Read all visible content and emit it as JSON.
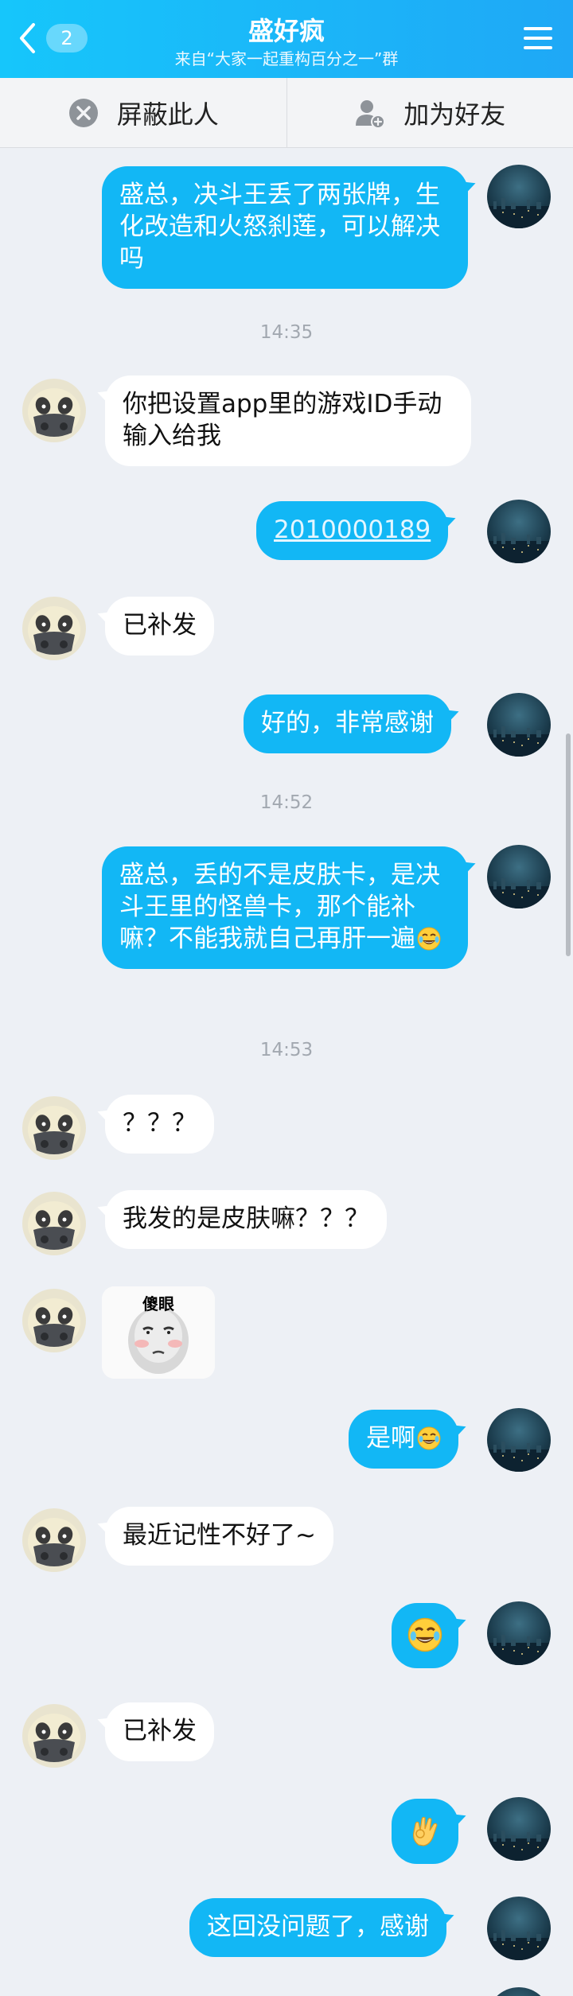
{
  "header": {
    "unread_count": "2",
    "title": "盛好疯",
    "subtitle": "来自“大家一起重构百分之一”群",
    "accent": "#12b7f5"
  },
  "actions": {
    "block_label": "屏蔽此人",
    "add_friend_label": "加为好友"
  },
  "messages": {
    "m1": "盛总，决斗王丢了两张牌，生化改造和火怒刹莲，可以解决吗",
    "t1": "14:35",
    "m2": "你把设置app里的游戏ID手动输入给我",
    "m3": "2010000189",
    "m4": "已补发",
    "m5": "好的，非常感谢",
    "t2": "14:52",
    "m6": "盛总，丢的不是皮肤卡，是决斗王里的怪兽卡，那个能补嘛？不能我就自己再肝一遍",
    "t3": "14:53",
    "m7": "？？？",
    "m8": "我发的是皮肤嘛？？？",
    "sticker_text": "傻眼",
    "m9": "是啊",
    "m10": "最近记性不好了~",
    "m11": "已补发",
    "m12": "这回没问题了，感谢"
  },
  "icons": {
    "back": "chevron-left-icon",
    "menu": "hamburger-menu-icon",
    "block": "block-user-icon",
    "add_friend": "add-friend-icon",
    "laugh": "tears-of-joy-emoji",
    "ok": "ok-hand-emoji"
  }
}
